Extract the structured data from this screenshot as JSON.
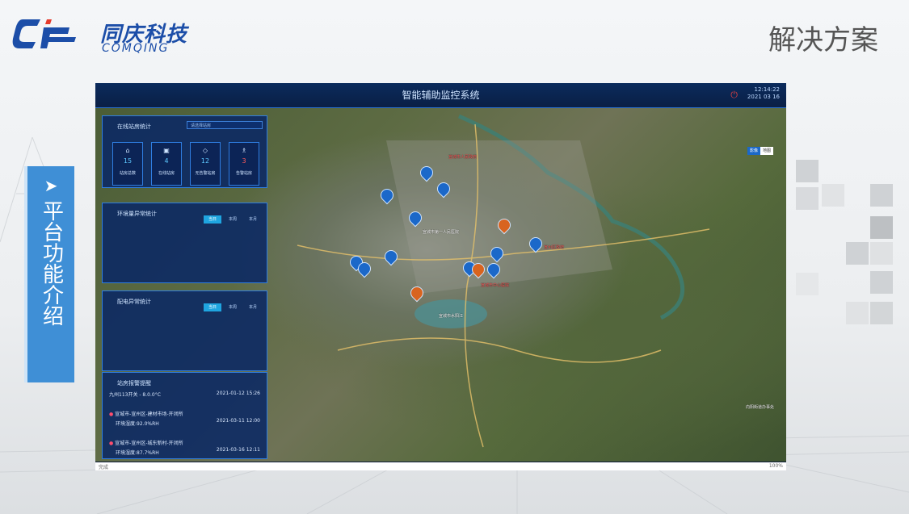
{
  "header": {
    "logo_cn": "同庆科技",
    "logo_en": "COMQING",
    "slide_title": "解决方案"
  },
  "side_tab": {
    "arrow": "➤",
    "label": "平台功能介绍"
  },
  "system": {
    "title": "智能辅助监控系统",
    "power_icon": "⏻",
    "clock_time": "12:14:22",
    "clock_date": "2021 03 16"
  },
  "online_panel": {
    "title": "在线站房统计",
    "select_placeholder": "请选择站房",
    "stats": [
      {
        "icon": "⌂",
        "value": "15",
        "label": "站房总数"
      },
      {
        "icon": "▣",
        "value": "4",
        "label": "在线站房"
      },
      {
        "icon": "◇",
        "value": "12",
        "label": "无告警站房"
      },
      {
        "icon": "♗",
        "value": "3",
        "label": "告警站房"
      }
    ]
  },
  "env_panel": {
    "title": "环境量异常统计",
    "tabs": [
      "当日",
      "本周",
      "本月"
    ]
  },
  "power_panel": {
    "title": "配电异常统计",
    "tabs": [
      "当日",
      "本周",
      "本月"
    ]
  },
  "alarm_panel": {
    "title": "站房报警提醒",
    "items": [
      {
        "name": "九州113开关 - 8.0.0°C",
        "line2": "",
        "time": "2021-01-12 15:26",
        "dot": ""
      },
      {
        "name": "宣城市-宣州区-建材市场-开闭所",
        "line2": "环境湿度:92.0%RH",
        "time": "2021-03-11 12:00",
        "dot": "●"
      },
      {
        "name": "宣城市-宣州区-城东新村-开闭所",
        "line2": "环境湿度:87.7%RH",
        "time": "2021-03-16 12:11",
        "dot": "●"
      }
    ]
  },
  "map_toggle": [
    "影像",
    "地图"
  ],
  "map_labels": [
    {
      "text": "宣城市人民政府",
      "color": "red"
    },
    {
      "text": "宣城市中心医院",
      "color": "red"
    },
    {
      "text": "宣城市第一人民医院",
      "color": "white"
    },
    {
      "text": "宣州区政府",
      "color": "red"
    },
    {
      "text": "宣城市水阳江",
      "color": "white"
    },
    {
      "text": "向阳街道办事处",
      "color": "white"
    }
  ],
  "status_bar": {
    "left": "完成",
    "right": "100%"
  },
  "colors": {
    "brand": "#1c4ea8",
    "side_tab": "#3f8fd6",
    "panel_border": "#2f7de0",
    "accent_tab": "#1fa5e0",
    "alarm_dot": "#ff4d6d"
  }
}
